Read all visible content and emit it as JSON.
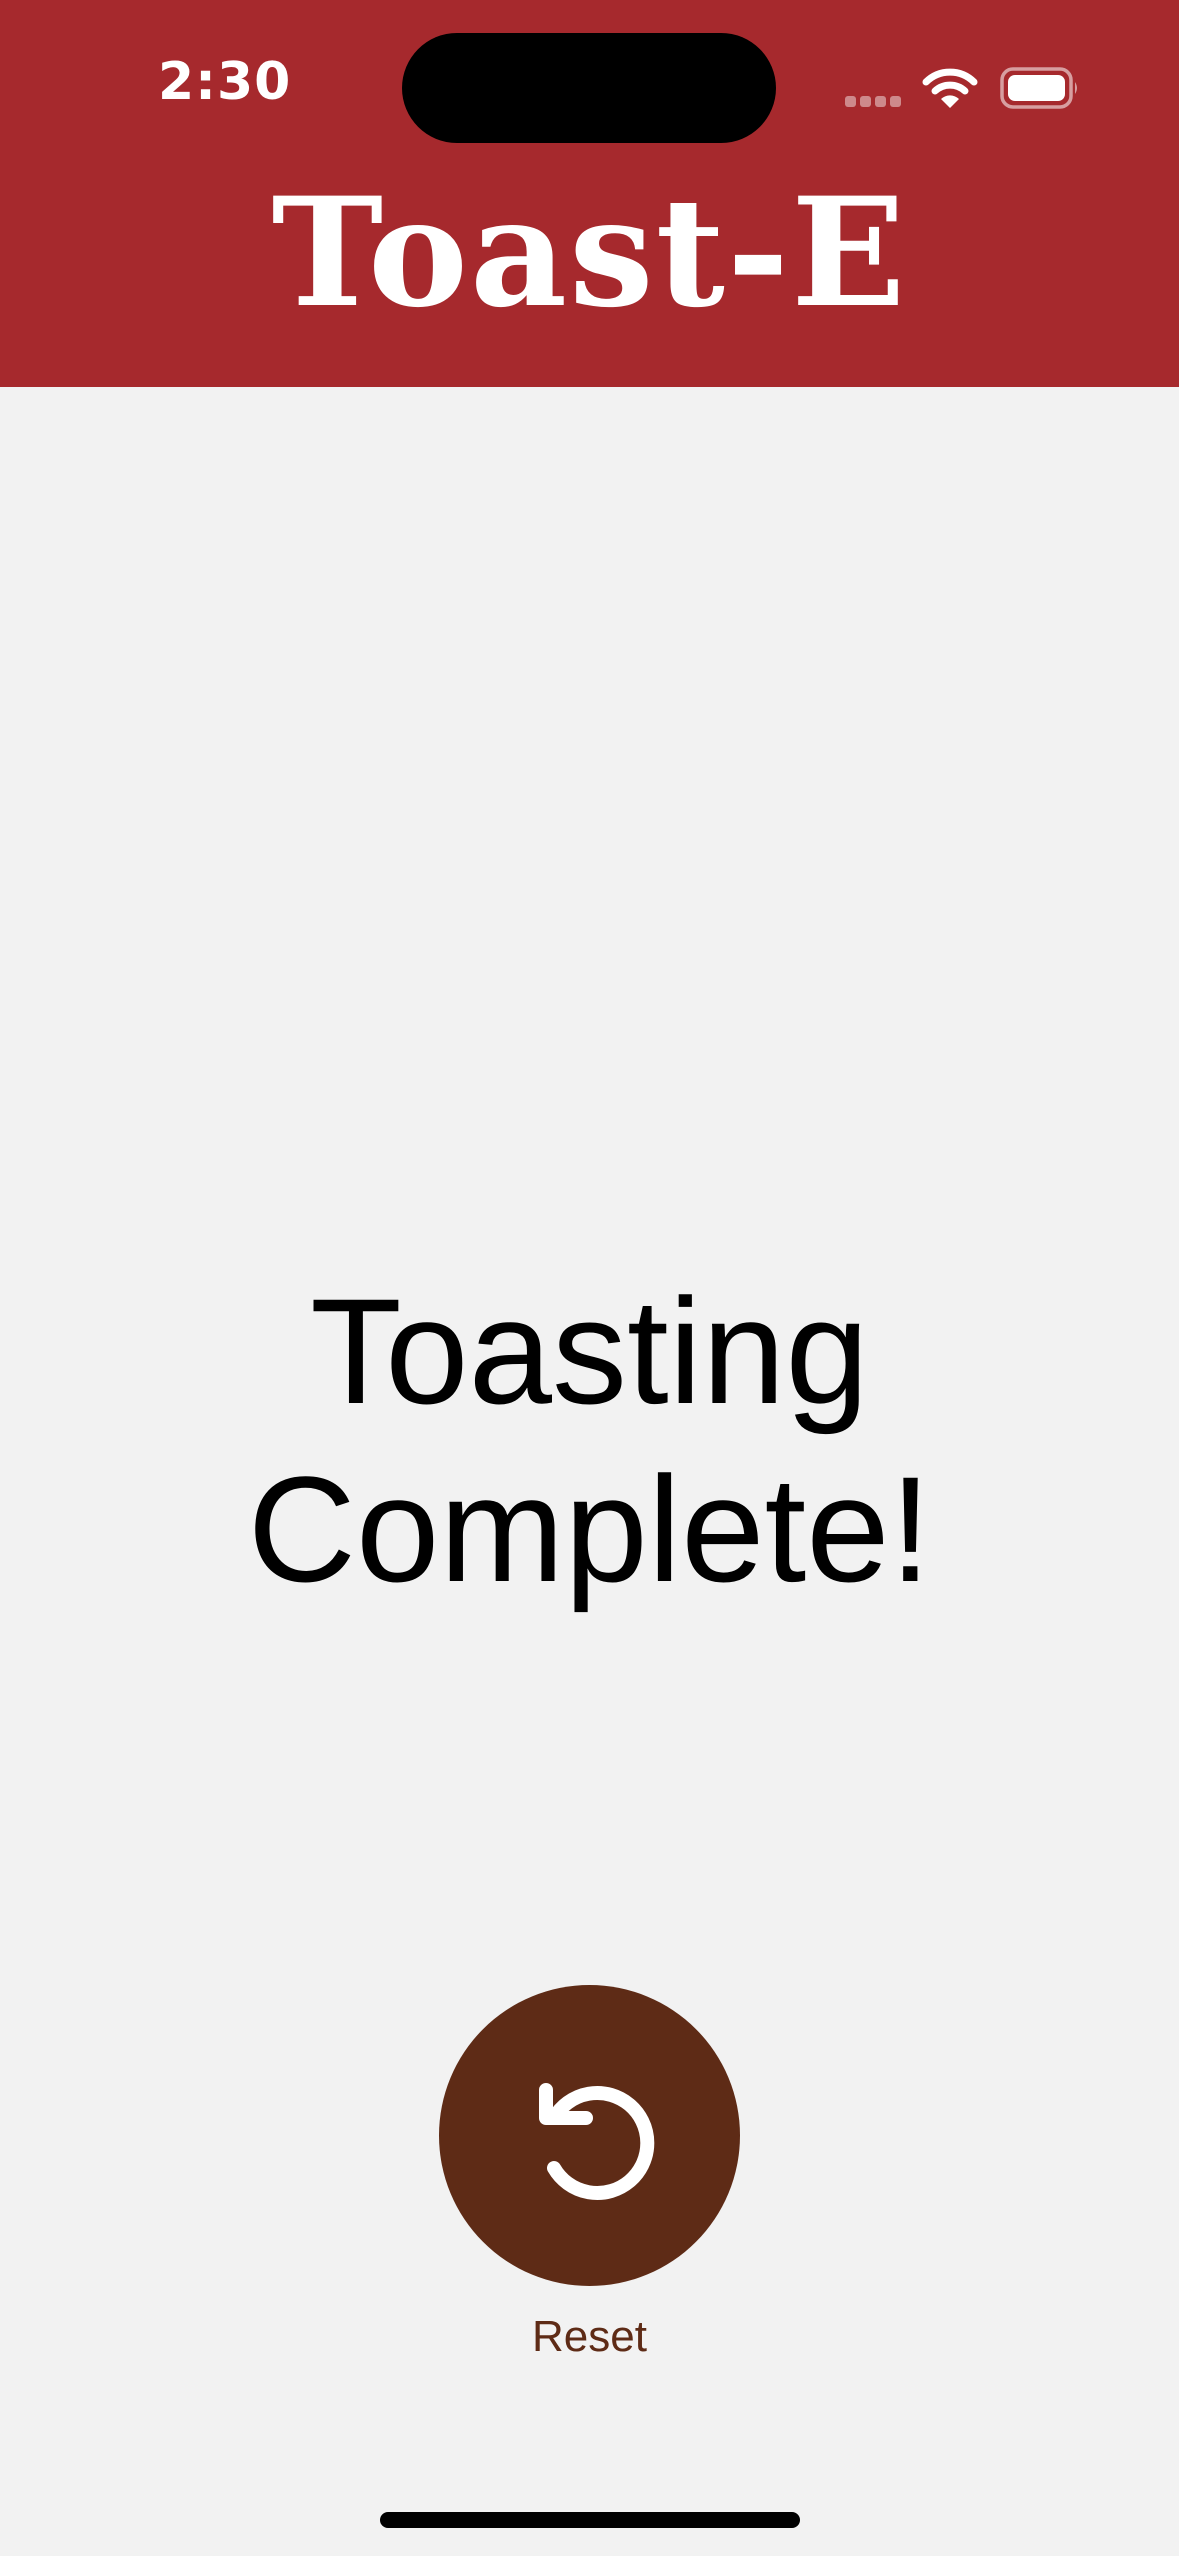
{
  "status_bar": {
    "time": "2:30"
  },
  "header": {
    "title": "Toast-E",
    "background_color": "#a6292d"
  },
  "main": {
    "message": "Toasting Complete!"
  },
  "reset": {
    "icon": "reset-icon",
    "label": "Reset",
    "color": "#5e2b16"
  }
}
